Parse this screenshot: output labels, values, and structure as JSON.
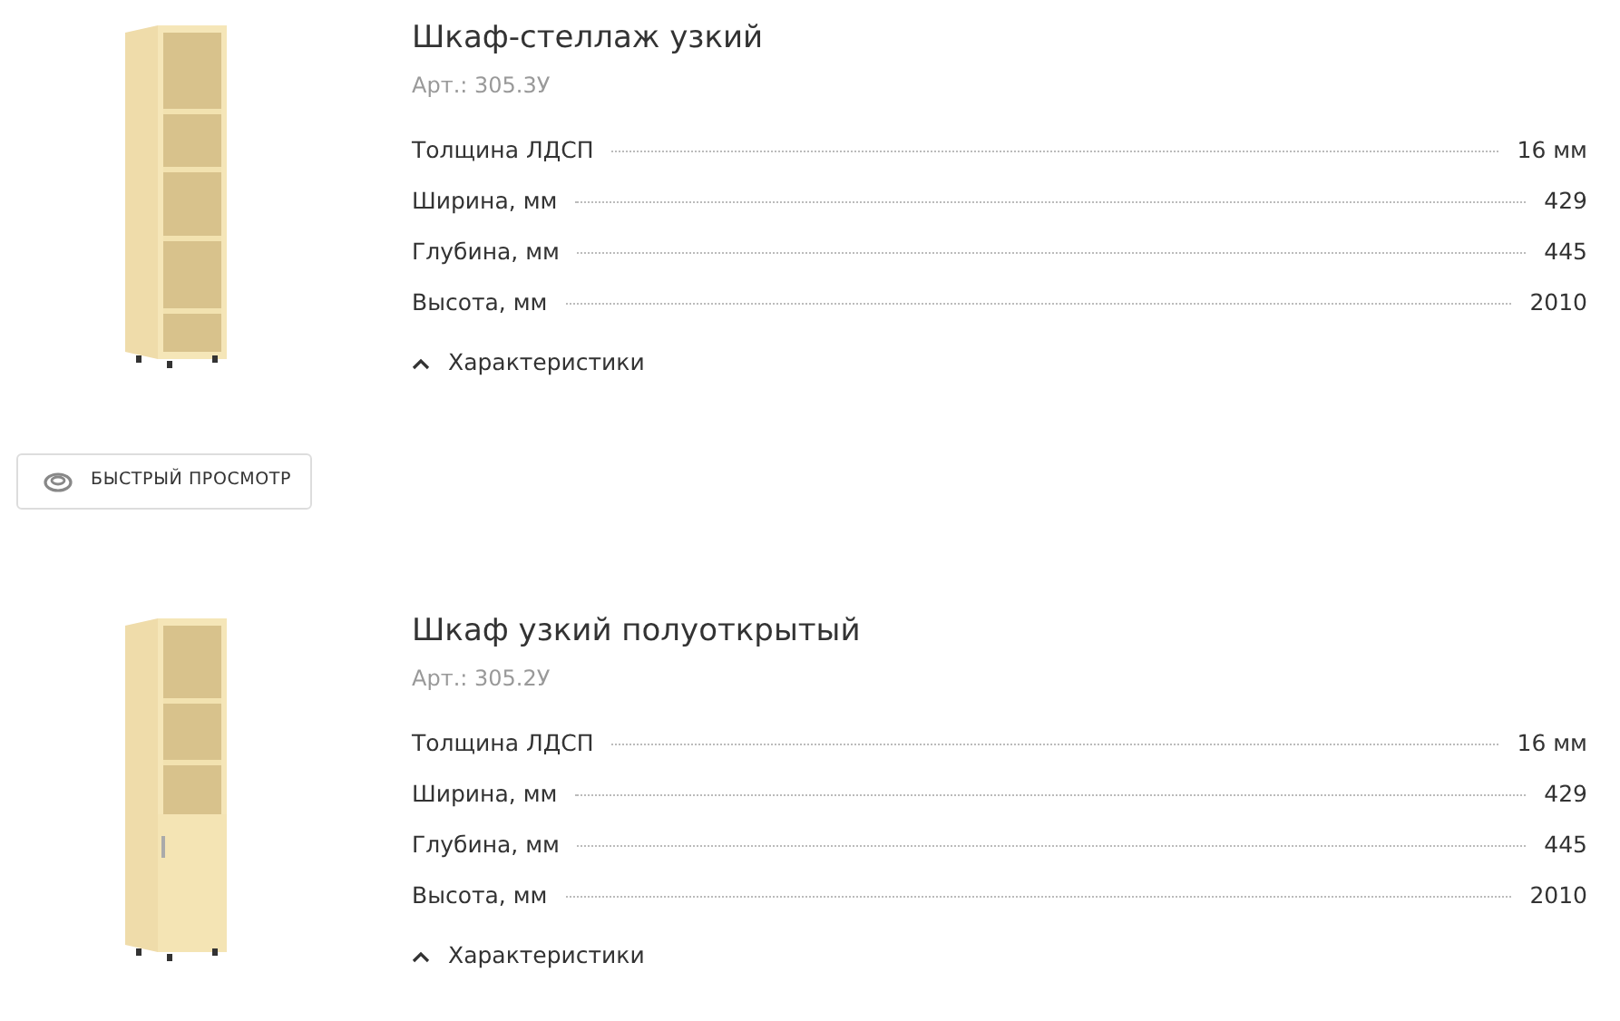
{
  "products": [
    {
      "title": "Шкаф-стеллаж узкий",
      "article": "Арт.: 305.3У",
      "specs": [
        {
          "label": "Толщина ЛДСП",
          "value": "16 мм"
        },
        {
          "label": "Ширина, мм",
          "value": "429"
        },
        {
          "label": "Глубина, мм",
          "value": "445"
        },
        {
          "label": "Высота, мм",
          "value": "2010"
        }
      ],
      "toggle": {
        "label": "Характеристики",
        "expanded": true
      },
      "quick_view": {
        "label": "БЫСТРЫЙ ПРОСМОТР"
      }
    },
    {
      "title": "Шкаф узкий полуоткрытый",
      "article": "Арт.: 305.2У",
      "specs": [
        {
          "label": "Толщина ЛДСП",
          "value": "16 мм"
        },
        {
          "label": "Ширина, мм",
          "value": "429"
        },
        {
          "label": "Глубина, мм",
          "value": "445"
        },
        {
          "label": "Высота, мм",
          "value": "2010"
        }
      ],
      "toggle": {
        "label": "Характеристики",
        "expanded": true
      }
    }
  ]
}
